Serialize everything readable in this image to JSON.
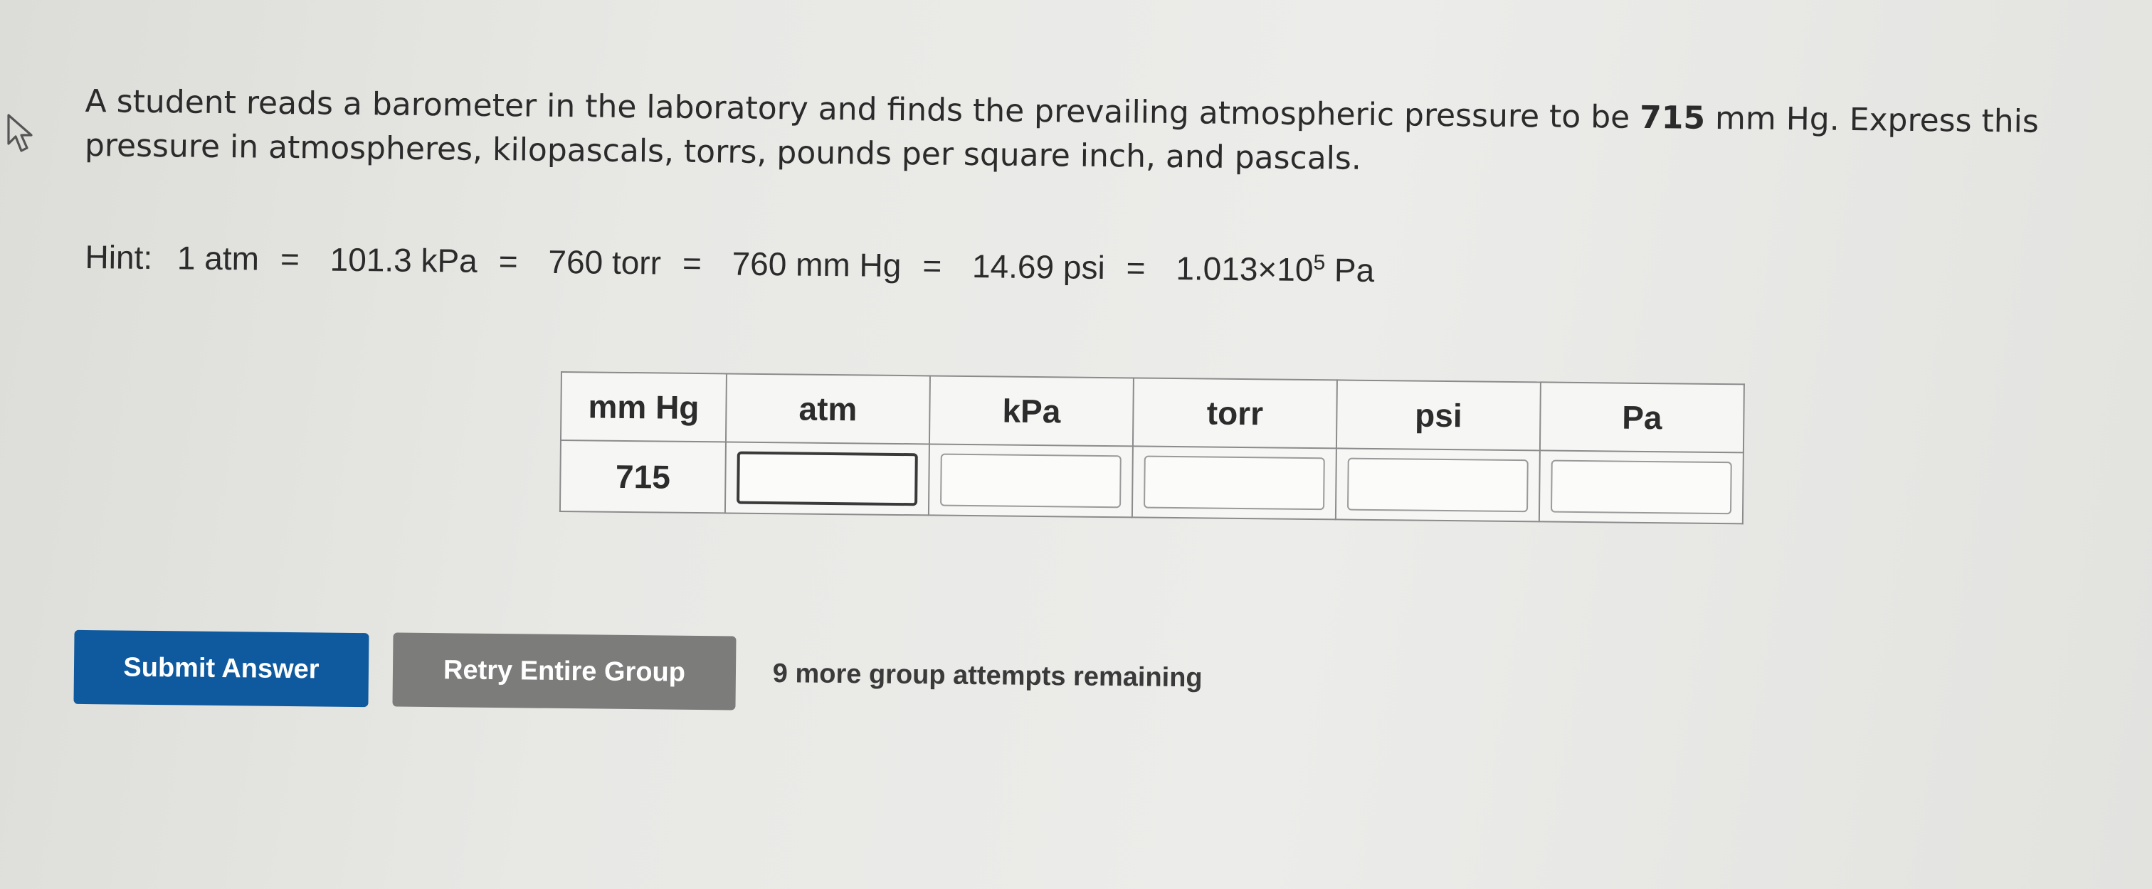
{
  "question": {
    "text_before": "A student reads a barometer in the laboratory and finds the prevailing atmospheric pressure to be ",
    "value": "715",
    "text_after": " mm Hg. Express this pressure in atmospheres, kilopascals, torrs, pounds per square inch, and pascals."
  },
  "hint": {
    "label": "Hint:",
    "parts": [
      "1 atm",
      "101.3 kPa",
      "760 torr",
      "760 mm Hg",
      "14.69 psi"
    ],
    "equals": "=",
    "sci_mantissa": "1.013×10",
    "sci_exponent": "5",
    "sci_unit": "Pa"
  },
  "table": {
    "headers": [
      "mm Hg",
      "atm",
      "kPa",
      "torr",
      "psi",
      "Pa"
    ],
    "given_value": "715",
    "inputs": [
      {
        "unit": "atm",
        "value": ""
      },
      {
        "unit": "kPa",
        "value": ""
      },
      {
        "unit": "torr",
        "value": ""
      },
      {
        "unit": "psi",
        "value": ""
      },
      {
        "unit": "Pa",
        "value": ""
      }
    ]
  },
  "actions": {
    "submit_label": "Submit Answer",
    "retry_label": "Retry Entire Group",
    "attempts_text": "9 more group attempts remaining"
  },
  "colors": {
    "submit_bg": "#0f5a9e",
    "retry_bg": "#7c7d7b"
  }
}
